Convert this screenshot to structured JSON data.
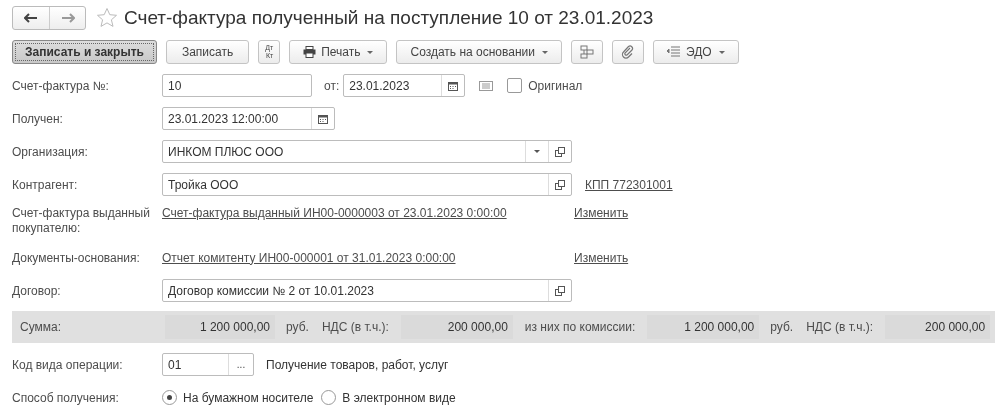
{
  "window": {
    "title": "Счет-фактура полученный на поступление 10 от 23.01.2023"
  },
  "toolbar": [
    {
      "kind": "primary",
      "label": "Записать и закрыть"
    },
    {
      "kind": "button",
      "label": "Записать"
    },
    {
      "kind": "dtkt",
      "top": "Дт",
      "bottom": "Кт"
    },
    {
      "kind": "print",
      "label": "Печать"
    },
    {
      "kind": "menu",
      "label": "Создать на основании"
    },
    {
      "kind": "structure"
    },
    {
      "kind": "attach"
    },
    {
      "kind": "edo",
      "label": "ЭДО"
    }
  ],
  "invoice": {
    "label": "Счет-фактура №:",
    "number": "10",
    "date_label": "от:",
    "date": "23.01.2023",
    "original": {
      "label": "Оригинал",
      "checked": false
    }
  },
  "received": {
    "label": "Получен:",
    "value": "23.01.2023 12:00:00"
  },
  "organization": {
    "label": "Организация:",
    "value": "ИНКОМ ПЛЮС ООО"
  },
  "counterparty": {
    "label": "Контрагент:",
    "value": "Тройка ООО",
    "kpp": "КПП 772301001"
  },
  "issued_invoice": {
    "label": "Счет-фактура выданный покупателю:",
    "link": "Счет-фактура выданный ИН00-0000003 от 23.01.2023 0:00:00",
    "action": "Изменить"
  },
  "base_documents": {
    "label": "Документы-основания:",
    "link": "Отчет комитенту ИН00-000001 от 31.01.2023 0:00:00",
    "action": "Изменить"
  },
  "contract": {
    "label": "Договор:",
    "value": "Договор комиссии № 2 от 10.01.2023"
  },
  "totals": {
    "label": "Сумма:",
    "amount": "1 200 000,00",
    "currency": "руб.",
    "vat_label": "НДС (в т.ч.):",
    "vat": "200 000,00",
    "commission_label": "из них по комиссии:",
    "commission_amount": "1 200 000,00",
    "commission_currency": "руб.",
    "commission_vat_label": "НДС (в т.ч.):",
    "commission_vat": "200 000,00"
  },
  "operation_code": {
    "label": "Код вида операции:",
    "value": "01",
    "button": "...",
    "description": "Получение товаров, работ, услуг"
  },
  "receipt_method": {
    "label": "Способ получения:",
    "options": [
      {
        "label": "На бумажном носителе",
        "selected": true
      },
      {
        "label": "В электронном виде",
        "selected": false
      }
    ]
  }
}
